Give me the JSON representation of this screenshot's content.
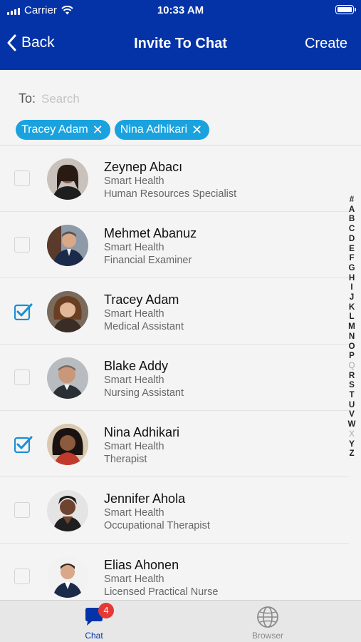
{
  "status": {
    "carrier": "Carrier",
    "time": "10:33 AM"
  },
  "nav": {
    "back_label": "Back",
    "title": "Invite To Chat",
    "create_label": "Create"
  },
  "to": {
    "label": "To:",
    "placeholder": "Search"
  },
  "chips": [
    {
      "label": "Tracey Adam"
    },
    {
      "label": "Nina Adhikari"
    }
  ],
  "contacts": [
    {
      "name": "Zeynep Abacı",
      "org": "Smart Health",
      "title": "Human Resources Specialist",
      "checked": false
    },
    {
      "name": "Mehmet Abanuz",
      "org": "Smart Health",
      "title": "Financial Examiner",
      "checked": false
    },
    {
      "name": "Tracey Adam",
      "org": "Smart Health",
      "title": "Medical Assistant",
      "checked": true
    },
    {
      "name": "Blake Addy",
      "org": "Smart Health",
      "title": "Nursing Assistant",
      "checked": false
    },
    {
      "name": "Nina Adhikari",
      "org": "Smart Health",
      "title": "Therapist",
      "checked": true
    },
    {
      "name": "Jennifer Ahola",
      "org": "Smart Health",
      "title": "Occupational Therapist",
      "checked": false
    },
    {
      "name": "Elias Ahonen",
      "org": "Smart Health",
      "title": "Licensed Practical Nurse",
      "checked": false
    }
  ],
  "alpha_index": [
    "#",
    "A",
    "B",
    "C",
    "D",
    "E",
    "F",
    "G",
    "H",
    "I",
    "J",
    "K",
    "L",
    "M",
    "N",
    "O",
    "P",
    "Q",
    "R",
    "S",
    "T",
    "U",
    "V",
    "W",
    "X",
    "Y",
    "Z"
  ],
  "alpha_dim": [
    "Q",
    "X"
  ],
  "tabs": {
    "chat": {
      "label": "Chat",
      "badge": "4",
      "icon": "chat-bubble-icon"
    },
    "browser": {
      "label": "Browser",
      "icon": "globe-icon"
    }
  },
  "colors": {
    "nav_bg": "#0433a8",
    "accent": "#1aa2df",
    "badge": "#e53935"
  }
}
